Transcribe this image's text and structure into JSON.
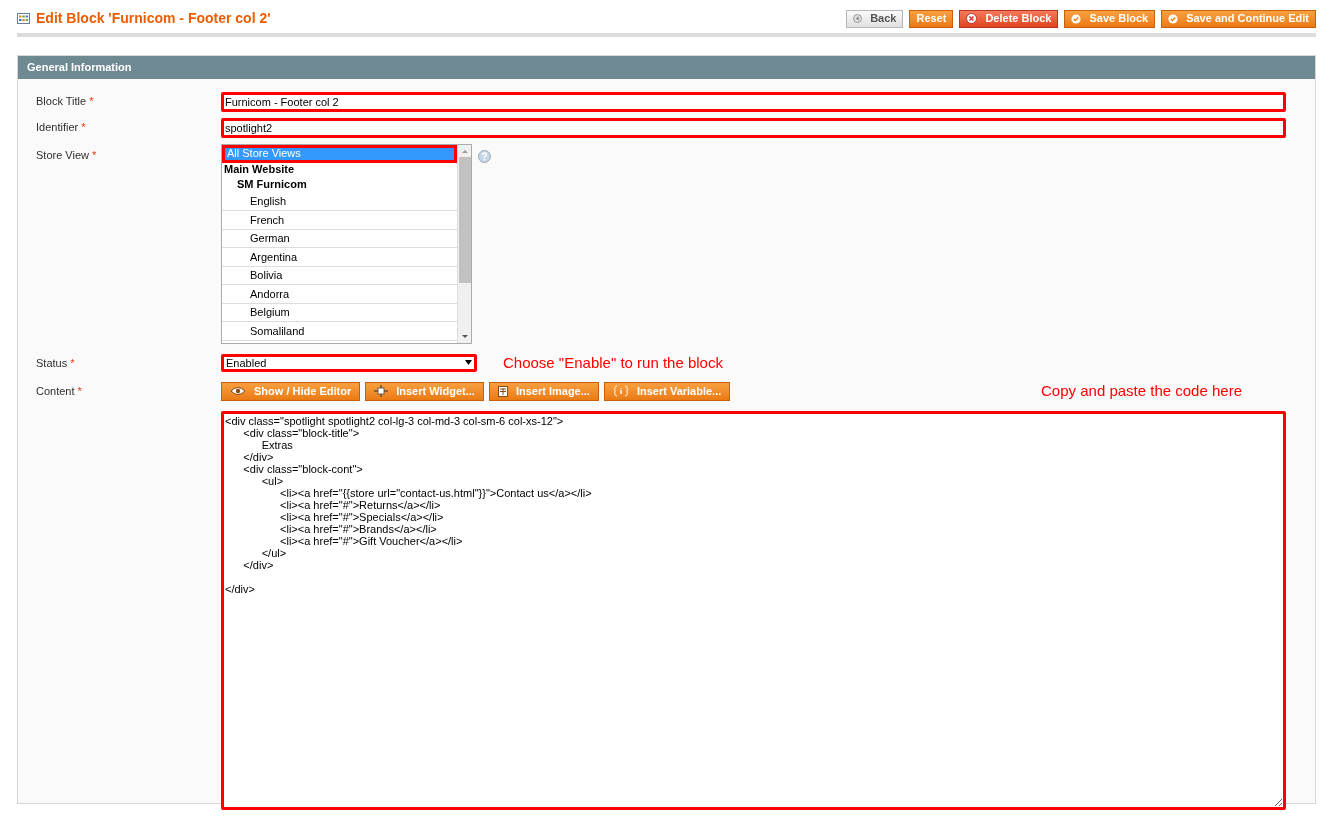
{
  "page_title": "Edit Block 'Furnicom - Footer col 2'",
  "header_buttons": [
    {
      "label": "Back",
      "kind": "back"
    },
    {
      "label": "Reset",
      "kind": "plain"
    },
    {
      "label": "Delete Block",
      "kind": "delete"
    },
    {
      "label": "Save Block",
      "kind": "save"
    },
    {
      "label": "Save and Continue Edit",
      "kind": "save"
    }
  ],
  "section_title": "General Information",
  "block_title": {
    "label": "Block Title",
    "required_mark": "*",
    "value": "Furnicom - Footer col 2",
    "annotated": true
  },
  "identifier": {
    "label": "Identifier",
    "required_mark": "*",
    "value": "spotlight2",
    "annotated": true
  },
  "store_view": {
    "label": "Store View",
    "required_mark": "*",
    "options": [
      {
        "text": "All Store Views",
        "kind": "option0",
        "selected": true,
        "annotated": true
      },
      {
        "text": "Main Website",
        "kind": "group",
        "selected": false,
        "annotated": false
      },
      {
        "text": "SM Furnicom",
        "kind": "subgroup",
        "selected": false,
        "annotated": false
      },
      {
        "text": "English",
        "kind": "option",
        "selected": false,
        "annotated": false
      },
      {
        "text": "French",
        "kind": "option",
        "selected": false,
        "annotated": false
      },
      {
        "text": "German",
        "kind": "option",
        "selected": false,
        "annotated": false
      },
      {
        "text": "Argentina",
        "kind": "option",
        "selected": false,
        "annotated": false
      },
      {
        "text": "Bolivia",
        "kind": "option",
        "selected": false,
        "annotated": false
      },
      {
        "text": "Andorra",
        "kind": "option",
        "selected": false,
        "annotated": false
      },
      {
        "text": "Belgium",
        "kind": "option",
        "selected": false,
        "annotated": false
      },
      {
        "text": "Somaliland",
        "kind": "option",
        "selected": false,
        "annotated": false
      }
    ]
  },
  "status": {
    "label": "Status",
    "required_mark": "*",
    "value": "Enabled",
    "annotated": true,
    "note": "Choose \"Enable\" to run the block"
  },
  "content": {
    "label": "Content",
    "required_mark": "*",
    "annotated": true,
    "note": "Copy and paste the code here",
    "editor_buttons": [
      {
        "label": "Show / Hide Editor",
        "kind": "eye"
      },
      {
        "label": "Insert Widget...",
        "kind": "widget"
      },
      {
        "label": "Insert Image...",
        "kind": "image"
      },
      {
        "label": "Insert Variable...",
        "kind": "variable"
      }
    ],
    "code": "<div class=\"spotlight spotlight2 col-lg-3 col-md-3 col-sm-6 col-xs-12\">\n\t<div class=\"block-title\">\n\t\tExtras\n\t</div>\n\t<div class=\"block-cont\">\n\t\t<ul>\n\t\t\t<li><a href=\"{{store url=\"contact-us.html\"}}\">Contact us</a></li>\n\t\t\t<li><a href=\"#\">Returns</a></li>\n\t\t\t<li><a href=\"#\">Specials</a></li>\n\t\t\t<li><a href=\"#\">Brands</a></li>\n\t\t\t<li><a href=\"#\">Gift Voucher</a></li>\n\t\t</ul>\n\t</div>\n\n</div>"
  }
}
